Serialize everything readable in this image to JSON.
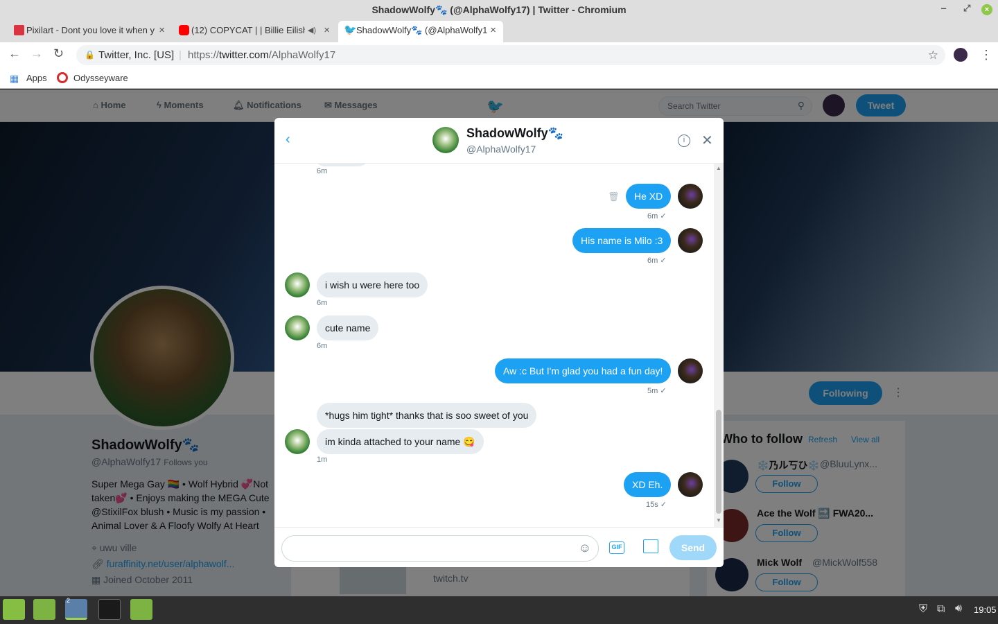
{
  "window": {
    "title": "ShadowWolfy🐾 (@AlphaWolfy17) | Twitter - Chromium"
  },
  "tabs": [
    {
      "label": "Pixilart - Dont you love it when y",
      "close": "×"
    },
    {
      "label": "(12) COPYCAT | | Billie Eilish",
      "close": "×",
      "audio": "◀)"
    },
    {
      "label": "ShadowWolfy🐾 (@AlphaWolfy1",
      "close": "×"
    }
  ],
  "toolbar": {
    "security": "Twitter, Inc. [US]",
    "url_scheme": "https://",
    "url_host": "twitter.com",
    "url_path": "/AlphaWolfy17"
  },
  "bookmarks": [
    {
      "label": "Apps"
    },
    {
      "label": "Odysseyware"
    }
  ],
  "twitter_nav": {
    "home": "Home",
    "moments": "Moments",
    "notifications": "Notifications",
    "messages": "Messages",
    "search_placeholder": "Search Twitter",
    "tweet": "Tweet"
  },
  "profile": {
    "name": "ShadowWolfy🐾",
    "handle": "@AlphaWolfy17",
    "follows_you": "Follows you",
    "bio_lines": [
      "Super Mega Gay 🏳️‍🌈 • Wolf Hybrid 💞Not",
      "taken💕 • Enjoys making the MEGA Cute",
      "@StixilFox blush • Music is my passion •",
      "Animal Lover & A Floofy Wolfy At Heart"
    ],
    "location": "uwu ville",
    "link": "furaffinity.net/user/alphawolf...",
    "joined": "Joined October 2011",
    "following_button": "Following",
    "media_caption": "twitch.tv"
  },
  "who_to_follow": {
    "title": "Who to follow",
    "refresh": "Refresh",
    "view_all": "View all",
    "users": [
      {
        "name": "❄️乃ル丂ひ❄️",
        "handle": "@BluuLynx...",
        "follow": "Follow"
      },
      {
        "name": "Ace the Wolf 🔜 FWA20...",
        "handle": "",
        "follow": "Follow"
      },
      {
        "name": "Mick Wolf",
        "handle": "@MickWolf558",
        "follow": "Follow"
      }
    ]
  },
  "dm": {
    "name": "ShadowWolfy🐾",
    "handle": "@AlphaWolfy17",
    "messages": [
      {
        "text": "He XD",
        "time": "6m ✓"
      },
      {
        "text": "His name is Milo :3",
        "time": "6m ✓"
      },
      {
        "text": "i wish u were here too",
        "time": "6m"
      },
      {
        "text": "cute name",
        "time": "6m"
      },
      {
        "text": "Aw :c But I'm glad you had a fun day!",
        "time": "5m ✓"
      },
      {
        "text": "*hugs him tight* thanks that is soo sweet of you",
        "time": ""
      },
      {
        "text": "im kinda attached to your name 😋",
        "time": "1m"
      },
      {
        "text": "XD Eh.",
        "time": "15s ✓"
      }
    ],
    "top_time": "6m",
    "composer": {
      "gif": "GIF",
      "send": "Send"
    }
  },
  "taskbar": {
    "clock": "19:05",
    "badge": "2"
  },
  "colors": {
    "twitter_blue": "#1da1f2",
    "bubble_gray": "#e6ecf0"
  }
}
